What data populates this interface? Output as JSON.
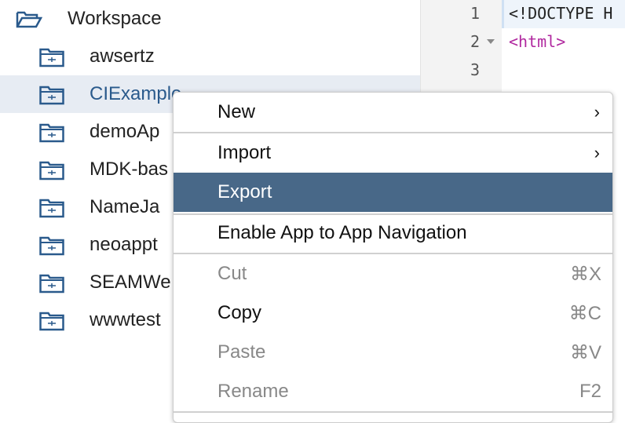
{
  "tree": {
    "root": "Workspace",
    "items": [
      "awsertz",
      "CIExample",
      "demoAp",
      "MDK-bas",
      "NameJa",
      "neoappt",
      "SEAMWe",
      "wwwtest"
    ],
    "selected_index": 1
  },
  "editor": {
    "line_numbers": [
      "1",
      "2",
      "3"
    ],
    "lines": [
      "<!DOCTYPE H",
      "<html>",
      ""
    ]
  },
  "menu": {
    "items": [
      {
        "label": "New",
        "submenu": true,
        "shortcut": "",
        "disabled": false
      },
      {
        "label": "Import",
        "submenu": true,
        "shortcut": "",
        "disabled": false
      },
      {
        "label": "Export",
        "submenu": false,
        "shortcut": "",
        "disabled": false,
        "highlighted": true
      },
      {
        "label": "Enable App to App Navigation",
        "submenu": false,
        "shortcut": "",
        "disabled": false
      },
      {
        "label": "Cut",
        "shortcut": "⌘X",
        "disabled": true
      },
      {
        "label": "Copy",
        "shortcut": "⌘C",
        "disabled": false
      },
      {
        "label": "Paste",
        "shortcut": "⌘V",
        "disabled": true
      },
      {
        "label": "Rename",
        "shortcut": "F2",
        "disabled": true
      }
    ],
    "arrow": "›"
  },
  "colors": {
    "highlight": "#486888",
    "selected_row": "#e7ecf3",
    "icon": "#2a5a8c",
    "tag": "#b0289f"
  }
}
